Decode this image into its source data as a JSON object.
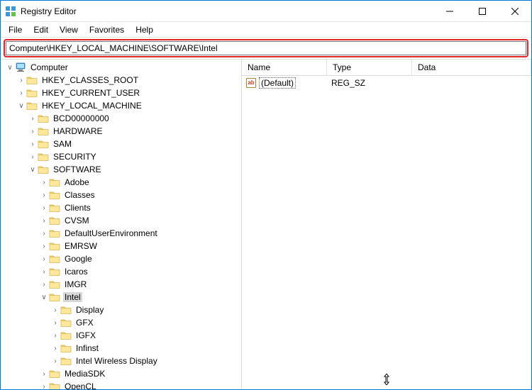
{
  "window": {
    "title": "Registry Editor"
  },
  "menu": {
    "file": "File",
    "edit": "Edit",
    "view": "View",
    "favorites": "Favorites",
    "help": "Help"
  },
  "address": {
    "value": "Computer\\HKEY_LOCAL_MACHINE\\SOFTWARE\\Intel"
  },
  "columns": {
    "name": "Name",
    "type": "Type",
    "data": "Data"
  },
  "values": [
    {
      "name": "(Default)",
      "type": "REG_SZ",
      "data": ""
    }
  ],
  "tree": {
    "root": "Computer",
    "hives": {
      "hkcr": "HKEY_CLASSES_ROOT",
      "hkcu": "HKEY_CURRENT_USER",
      "hklm": "HKEY_LOCAL_MACHINE"
    },
    "hklm_children": [
      "BCD00000000",
      "HARDWARE",
      "SAM",
      "SECURITY",
      "SOFTWARE"
    ],
    "software_children": [
      "Adobe",
      "Classes",
      "Clients",
      "CVSM",
      "DefaultUserEnvironment",
      "EMRSW",
      "Google",
      "Icaros",
      "IMGR",
      "Intel",
      "MediaSDK",
      "OpenCL"
    ],
    "intel_children": [
      "Display",
      "GFX",
      "IGFX",
      "Infinst",
      "Intel Wireless Display"
    ],
    "selected": "Intel"
  }
}
